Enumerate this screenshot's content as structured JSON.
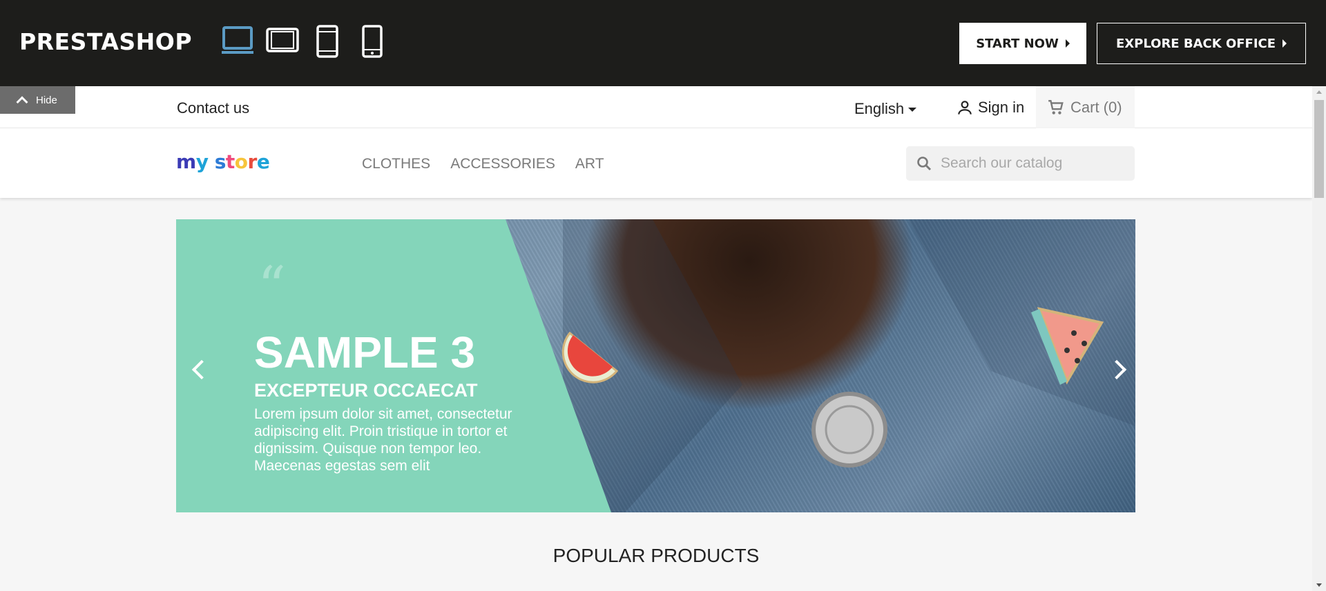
{
  "demo_bar": {
    "logo": "PRESTASHOP",
    "devices": [
      "desktop-icon",
      "tablet-landscape-icon",
      "tablet-portrait-icon",
      "mobile-icon"
    ],
    "start_label": "START NOW",
    "explore_label": "EXPLORE BACK OFFICE",
    "active_color": "#5b9bc4"
  },
  "hide_tab": {
    "label": "Hide"
  },
  "nav": {
    "contact": "Contact us",
    "language": "English",
    "signin": "Sign in",
    "cart": "Cart (0)"
  },
  "header": {
    "logo": {
      "text": "my store"
    },
    "menu": [
      "CLOTHES",
      "ACCESSORIES",
      "ART"
    ],
    "search_placeholder": "Search our catalog"
  },
  "slider": {
    "quote": "“",
    "title": "SAMPLE 3",
    "subtitle": "EXCEPTEUR OCCAECAT",
    "text": "Lorem ipsum dolor sit amet, consectetur adipiscing elit. Proin tristique in tortor et dignissim. Quisque non tempor leo. Maecenas egestas sem elit",
    "panel_color": "#84d5ba"
  },
  "section": {
    "title": "POPULAR PRODUCTS"
  }
}
